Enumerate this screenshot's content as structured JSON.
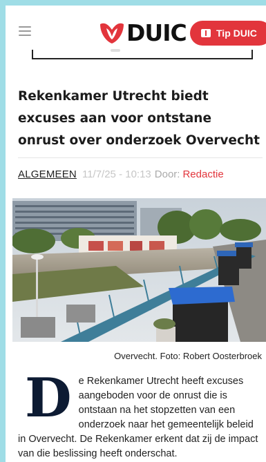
{
  "header": {
    "logo_text": "DUIC",
    "tip_label": "Tip DUIC",
    "brand_color": "#e2353c"
  },
  "article": {
    "title": "Rekenkamer Utrecht biedt excuses aan voor ontstane onrust over onderzoek Overvecht",
    "category": "ALGEMEEN",
    "date": "11/7/25 - 10:13",
    "by_label": "Door:",
    "author": "Redactie",
    "photo_caption": "Overvecht. Foto: Robert Oosterbroek",
    "dropcap": "D",
    "body": "e Rekenkamer Utrecht heeft excuses aangeboden voor de onrust die is ontstaan na het stopzetten van een onderzoek naar het gemeentelijk beleid in Overvecht. De Rekenkamer erkent dat zij de impact van die beslissing heeft onderschat."
  },
  "icons": [
    "menu-icon",
    "duic-logo-icon",
    "tip-flag-icon"
  ]
}
